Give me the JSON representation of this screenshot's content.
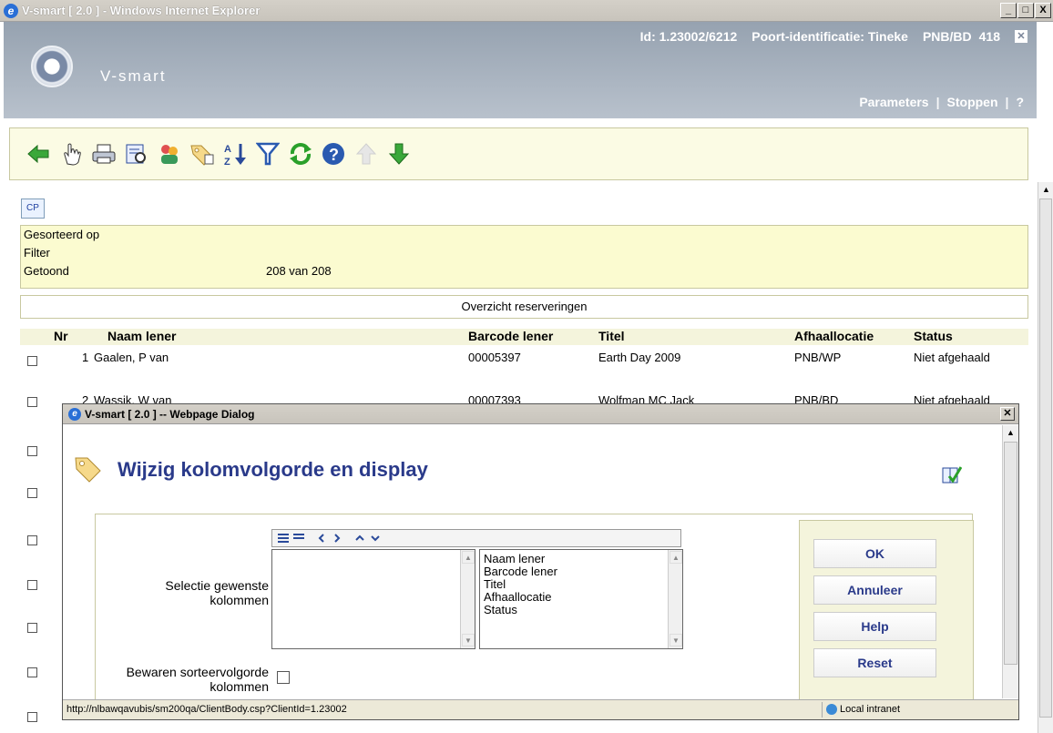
{
  "window": {
    "title": "V-smart [ 2.0 ] - Windows Internet Explorer",
    "min": "_",
    "max": "□",
    "close": "X"
  },
  "header": {
    "brand": "V-smart",
    "id": "Id: 1.23002/6212",
    "poort": "Poort-identificatie: Tineke",
    "location": "PNB/BD",
    "code": "418",
    "links": {
      "parameters": "Parameters",
      "stoppen": "Stoppen",
      "help": "?"
    }
  },
  "toolbar_icons": [
    "back-arrow-icon",
    "hand-icon",
    "print-icon",
    "preview-icon",
    "users-icon",
    "tag-icon",
    "sort-az-icon",
    "filter-icon",
    "refresh-icon",
    "help-icon",
    "arrow-up-icon",
    "arrow-down-icon"
  ],
  "cp_label": "CP",
  "info": {
    "sorted_label": "Gesorteerd op",
    "filter_label": "Filter",
    "shown_label": "Getoond",
    "shown_value": "208 van 208"
  },
  "overview_title": "Overzicht reserveringen",
  "table": {
    "headers": {
      "nr": "Nr",
      "naam": "Naam lener",
      "barcode": "Barcode lener",
      "titel": "Titel",
      "afhaal": "Afhaallocatie",
      "status": "Status"
    },
    "rows": [
      {
        "nr": "1",
        "naam": "Gaalen, P van",
        "barcode": "00005397",
        "titel": "Earth Day 2009",
        "afhaal": "PNB/WP",
        "status": "Niet afgehaald"
      },
      {
        "nr": "2",
        "naam": "Wassik, W van",
        "barcode": "00007393",
        "titel": "Wolfman MC Jack",
        "afhaal": "PNB/BD",
        "status": "Niet afgehaald"
      }
    ]
  },
  "dialog": {
    "title": "V-smart [ 2.0 ] -- Webpage Dialog",
    "heading": "Wijzig kolomvolgorde en display",
    "select_label": "Selectie gewenste kolommen",
    "keep_label": "Bewaren sorteervolgorde kolommen",
    "columns": [
      "Naam lener",
      "Barcode lener",
      "Titel",
      "Afhaallocatie",
      "Status"
    ],
    "buttons": {
      "ok": "OK",
      "cancel": "Annuleer",
      "help": "Help",
      "reset": "Reset"
    },
    "status_url": "http://nlbawqavubis/sm200qa/ClientBody.csp?ClientId=1.23002",
    "zone": "Local intranet"
  }
}
